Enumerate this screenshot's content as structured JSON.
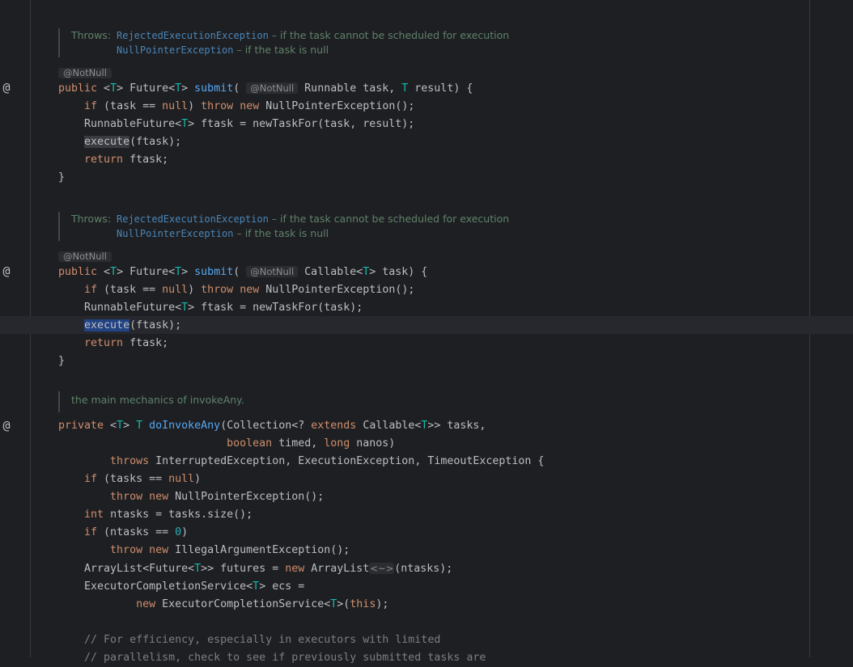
{
  "doc_blocks": [
    {
      "throws_label": "Throws:",
      "items": [
        {
          "exception": "RejectedExecutionException",
          "desc": " – if the task cannot be scheduled for execution"
        },
        {
          "exception": "NullPointerException",
          "desc": " – if the task is null"
        }
      ]
    },
    {
      "throws_label": "Throws:",
      "items": [
        {
          "exception": "RejectedExecutionException",
          "desc": " – if the task cannot be scheduled for execution"
        },
        {
          "exception": "NullPointerException",
          "desc": " – if the task is null"
        }
      ]
    },
    {
      "text": "the main mechanics of invokeAny."
    }
  ],
  "annotations": [
    "@NotNull",
    "@NotNull"
  ],
  "inlay_hints": {
    "param_annotation": "@NotNull",
    "diamond": "<~>"
  },
  "gutter_icons": [
    "implements-method-icon",
    "implements-method-icon",
    "implements-method-icon"
  ],
  "code": {
    "submit_runnable": [
      "public <T> Future<T> submit( Runnable task, T result) {",
      "    if (task == null) throw new NullPointerException();",
      "    RunnableFuture<T> ftask = newTaskFor(task, result);",
      "    execute(ftask);",
      "    return ftask;",
      "}"
    ],
    "submit_callable": [
      "public <T> Future<T> submit( Callable<T> task) {",
      "    if (task == null) throw new NullPointerException();",
      "    RunnableFuture<T> ftask = newTaskFor(task);",
      "    execute(ftask);",
      "    return ftask;",
      "}"
    ],
    "do_invoke_any": [
      "private <T> T doInvokeAny(Collection<? extends Callable<T>> tasks,",
      "                          boolean timed, long nanos)",
      "        throws InterruptedException, ExecutionException, TimeoutException {",
      "    if (tasks == null)",
      "        throw new NullPointerException();",
      "    int ntasks = tasks.size();",
      "    if (ntasks == 0)",
      "        throw new IllegalArgumentException();",
      "    ArrayList<Future<T>> futures = new ArrayList<~>(ntasks);",
      "    ExecutorCompletionService<T> ecs =",
      "            new ExecutorCompletionService<T>(this);",
      "",
      "    // For efficiency, especially in executors with limited",
      "    // parallelism, check to see if previously submitted tasks are"
    ]
  },
  "colors": {
    "background": "#1e1f22",
    "keyword": "#cf8e6d",
    "type_param": "#16baac",
    "method": "#56a8f5",
    "comment": "#7a7e85",
    "doc_text": "#5f826b",
    "doc_link": "#4a86b8",
    "selection": "#214283"
  }
}
